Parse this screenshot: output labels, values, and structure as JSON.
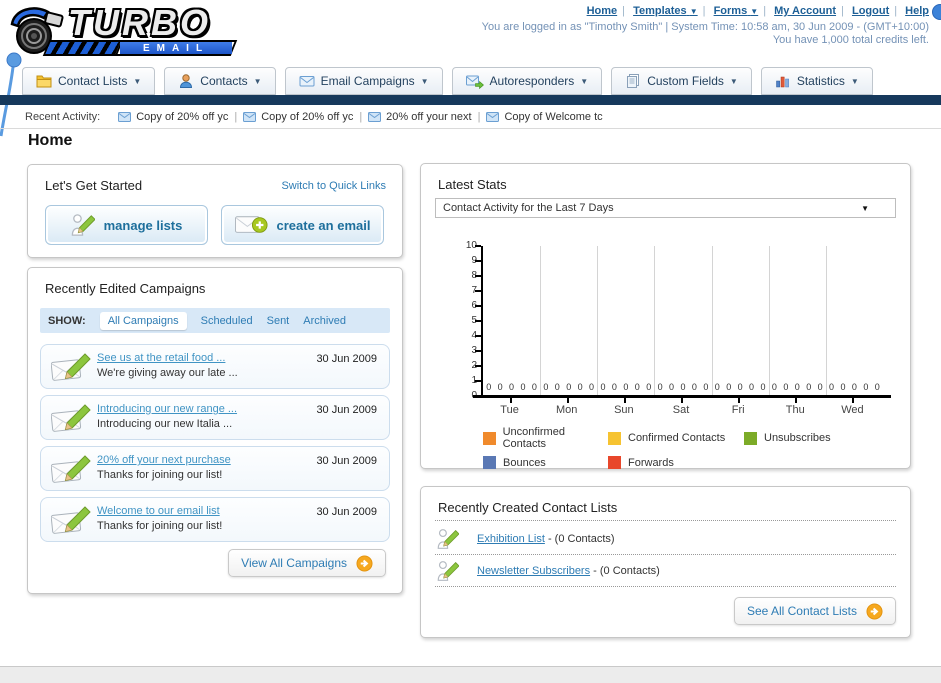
{
  "header": {
    "logo": {
      "title": "TURBO",
      "subtitle": "EMAIL"
    },
    "top_links": [
      {
        "label": "Home",
        "dropdown": false
      },
      {
        "label": "Templates",
        "dropdown": true
      },
      {
        "label": "Forms",
        "dropdown": true
      },
      {
        "label": "My Account",
        "dropdown": false
      },
      {
        "label": "Logout",
        "dropdown": false
      },
      {
        "label": "Help",
        "dropdown": false
      }
    ],
    "login_info": "You are logged in as \"Timothy Smith\" | System Time: 10:58 am, 30 Jun 2009 - (GMT+10:00)",
    "credits_info": "You have 1,000 total credits left."
  },
  "nav": {
    "items": [
      {
        "label": "Contact Lists",
        "icon": "folder-icon"
      },
      {
        "label": "Contacts",
        "icon": "contacts-icon"
      },
      {
        "label": "Email Campaigns",
        "icon": "envelope-icon"
      },
      {
        "label": "Autoresponders",
        "icon": "envelope-arrow-icon"
      },
      {
        "label": "Custom Fields",
        "icon": "pages-icon"
      },
      {
        "label": "Statistics",
        "icon": "bar-chart-icon"
      }
    ]
  },
  "recent_activity": {
    "label": "Recent Activity:",
    "items": [
      "Copy of 20% off yc",
      "Copy of 20% off yc",
      "20% off your next",
      "Copy of Welcome tc"
    ]
  },
  "page": {
    "title": "Home"
  },
  "get_started": {
    "title": "Let's Get Started",
    "switch_link": "Switch to Quick Links",
    "manage_label": "manage lists",
    "create_label": "create an email"
  },
  "campaigns": {
    "title": "Recently Edited Campaigns",
    "show_label": "SHOW:",
    "tabs": [
      "All Campaigns",
      "Scheduled",
      "Sent",
      "Archived"
    ],
    "active_tab": "All Campaigns",
    "items": [
      {
        "title": "See us at the retail food ...",
        "subtitle": "We're giving away our late ...",
        "date": "30 Jun 2009"
      },
      {
        "title": "Introducing our new range ...",
        "subtitle": "Introducing our new Italia ...",
        "date": "30 Jun 2009"
      },
      {
        "title": "20% off your next purchase",
        "subtitle": "Thanks for joining our list!",
        "date": "30 Jun 2009"
      },
      {
        "title": "Welcome to our email list",
        "subtitle": "Thanks for joining our list!",
        "date": "30 Jun 2009"
      }
    ],
    "view_all_label": "View All Campaigns"
  },
  "stats": {
    "title": "Latest Stats",
    "period_selected": "Contact Activity for the Last 7 Days"
  },
  "chart_data": {
    "type": "bar",
    "title": "Contact Activity for the Last 7 Days",
    "categories": [
      "Tue",
      "Mon",
      "Sun",
      "Sat",
      "Fri",
      "Thu",
      "Wed"
    ],
    "series": [
      {
        "name": "Unconfirmed Contacts",
        "color": "#f08a2c",
        "values": [
          0,
          0,
          0,
          0,
          0,
          0,
          0
        ]
      },
      {
        "name": "Confirmed Contacts",
        "color": "#f6c331",
        "values": [
          0,
          0,
          0,
          0,
          0,
          0,
          0
        ]
      },
      {
        "name": "Unsubscribes",
        "color": "#7cab28",
        "values": [
          0,
          0,
          0,
          0,
          0,
          0,
          0
        ]
      },
      {
        "name": "Bounces",
        "color": "#5a78b4",
        "values": [
          0,
          0,
          0,
          0,
          0,
          0,
          0
        ]
      },
      {
        "name": "Forwards",
        "color": "#e8472b",
        "values": [
          0,
          0,
          0,
          0,
          0,
          0,
          0
        ]
      }
    ],
    "ylim": [
      0,
      10
    ],
    "yticks": [
      0,
      1,
      2,
      3,
      4,
      5,
      6,
      7,
      8,
      9,
      10
    ],
    "grid": true,
    "legend_position": "bottom"
  },
  "contact_lists": {
    "title": "Recently Created Contact Lists",
    "items": [
      {
        "name": "Exhibition List",
        "detail": "- (0 Contacts)"
      },
      {
        "name": "Newsletter Subscribers",
        "detail": "- (0 Contacts)"
      }
    ],
    "see_all_label": "See All Contact Lists"
  }
}
